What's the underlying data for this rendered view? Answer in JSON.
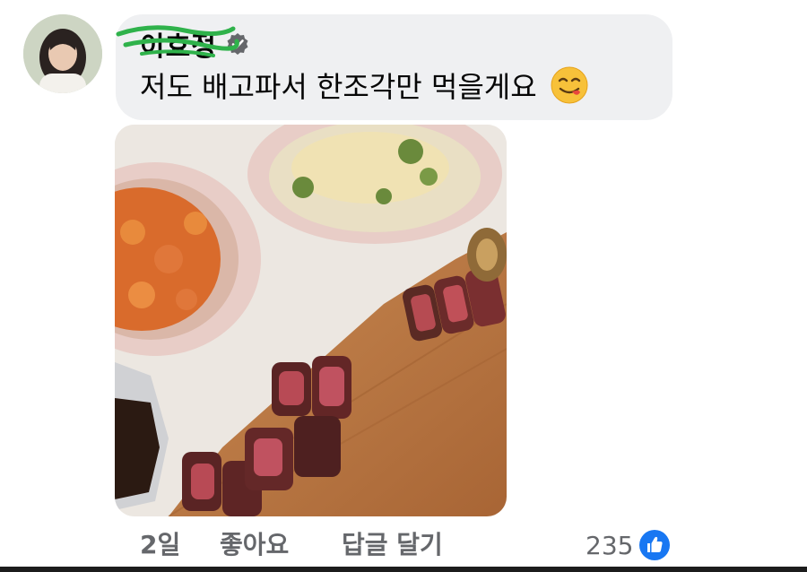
{
  "comment": {
    "author_name": "이효정",
    "verified_icon": "verified-badge-icon",
    "text": "저도 배고파서 한조각만 먹을게요",
    "emoji": "face-savoring-food-emoji",
    "attachment": "photo"
  },
  "actions": {
    "time": "2일",
    "like_label": "좋아요",
    "reply_label": "답글 달기"
  },
  "reactions": {
    "count": "235",
    "icon": "thumbs-up-icon"
  },
  "colors": {
    "bubble": "#eff0f2",
    "secondary_text": "#65676b",
    "like_blue": "#1877f2"
  }
}
